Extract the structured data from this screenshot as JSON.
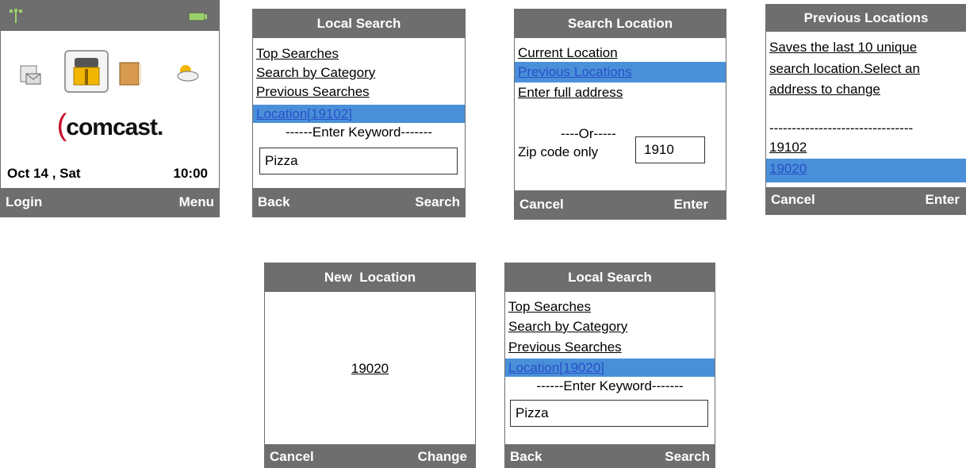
{
  "home": {
    "logo": "comcast.",
    "date": "Oct 14 , Sat",
    "time": "10:00",
    "soft_left": "Login",
    "soft_right": "Menu",
    "icons": [
      "signal-icon",
      "battery-icon",
      "message-icon",
      "phonebook-icon",
      "notebook-icon",
      "weather-icon"
    ]
  },
  "local_search_1": {
    "title": "Local Search",
    "items": [
      "Top Searches",
      "Search by Category",
      "Previous Searches",
      "Location[19102]"
    ],
    "keyword_label": "------Enter Keyword-------",
    "keyword_value": "Pizza",
    "soft_left": "Back",
    "soft_right": "Search"
  },
  "search_location": {
    "title": "Search Location",
    "items": [
      "Current Location",
      "Previous Locations",
      "Enter full address"
    ],
    "or_label": "----Or-----",
    "zip_label": "Zip code only",
    "zip_value": "1910",
    "soft_left": "Cancel",
    "soft_right": "Enter"
  },
  "previous_locations": {
    "title": "Previous Locations",
    "description": [
      "Saves the last 10 unique",
      "search location.Select an",
      "address to change"
    ],
    "divider": "--------------------------------",
    "items": [
      "19102",
      "19020"
    ],
    "soft_left": "Cancel",
    "soft_right": "Enter"
  },
  "new_location": {
    "title": "New  Location",
    "value": "19020",
    "soft_left": "Cancel",
    "soft_right": "Change"
  },
  "local_search_2": {
    "title": "Local Search",
    "items": [
      "Top Searches",
      "Search by Category",
      "Previous Searches",
      "Location[19020]"
    ],
    "keyword_label": "------Enter Keyword-------",
    "keyword_value": "Pizza",
    "soft_left": "Back",
    "soft_right": "Search"
  },
  "colors": {
    "bar": "#6e6e6e",
    "selection": "#4a90d9",
    "logo_red": "#c8102e"
  }
}
